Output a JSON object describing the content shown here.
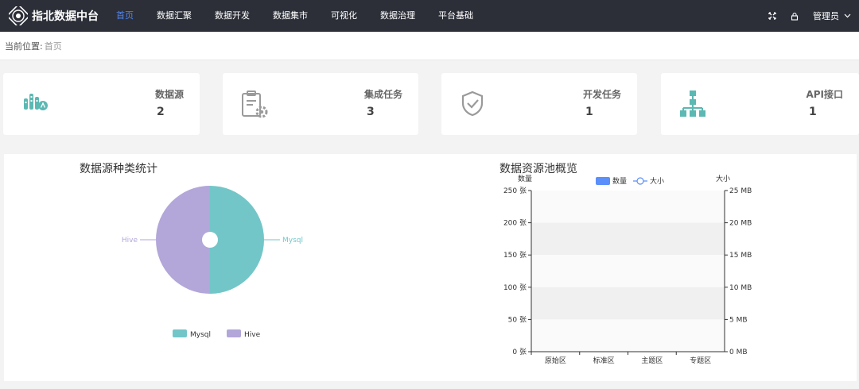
{
  "app": {
    "title": "指北数据中台"
  },
  "nav": [
    {
      "label": "首页",
      "active": true
    },
    {
      "label": "数据汇聚",
      "active": false
    },
    {
      "label": "数据开发",
      "active": false
    },
    {
      "label": "数据集市",
      "active": false
    },
    {
      "label": "可视化",
      "active": false
    },
    {
      "label": "数据治理",
      "active": false
    },
    {
      "label": "平台基础",
      "active": false
    }
  ],
  "header": {
    "fullscreen_icon": "fullscreen-icon",
    "lock_icon": "lock-icon",
    "user_name": "管理员"
  },
  "breadcrumb": {
    "label": "当前位置:",
    "current": "首页"
  },
  "stats": [
    {
      "label": "数据源",
      "value": "2",
      "icon": "datasource-icon"
    },
    {
      "label": "集成任务",
      "value": "3",
      "icon": "clipboard-gear-icon"
    },
    {
      "label": "开发任务",
      "value": "1",
      "icon": "shield-check-icon"
    },
    {
      "label": "API接口",
      "value": "1",
      "icon": "hierarchy-icon"
    }
  ],
  "colors": {
    "teal": "#73c6c8",
    "purple": "#b3a6d9",
    "blue": "#5b8ff9",
    "accent": "#4f86f7",
    "topbar": "#2c2f38",
    "icon_teal": "#5cb8b2"
  },
  "charts": {
    "left_title": "数据源种类统计",
    "right_title": "数据资源池概览"
  },
  "chart_data": [
    {
      "type": "pie",
      "title": "数据源种类统计",
      "labels": [
        "Mysql",
        "Hive"
      ],
      "values": [
        1,
        1
      ],
      "colors": [
        "#73c6c8",
        "#b3a6d9"
      ],
      "legend": [
        "Mysql",
        "Hive"
      ],
      "legend_position": "bottom-center"
    },
    {
      "type": "bar",
      "title": "数据资源池概览",
      "categories": [
        "原始区",
        "标准区",
        "主题区",
        "专题区"
      ],
      "series": [
        {
          "name": "数量",
          "type": "bar",
          "axis": "left",
          "values": [
            0,
            0,
            0,
            0
          ]
        },
        {
          "name": "大小",
          "type": "line",
          "axis": "right",
          "values": [
            0,
            0,
            0,
            0
          ]
        }
      ],
      "ylabel_left": "数量",
      "ylabel_right": "大小",
      "ylim_left": [
        0,
        250
      ],
      "ylim_right": [
        0,
        25
      ],
      "yticks_left": [
        "0 张",
        "50 张",
        "100 张",
        "150 张",
        "200 张",
        "250 张"
      ],
      "yticks_right": [
        "0 MB",
        "5 MB",
        "10 MB",
        "15 MB",
        "20 MB",
        "25 MB"
      ],
      "grid": "alternating-bands",
      "legend_position": "top-center"
    }
  ]
}
